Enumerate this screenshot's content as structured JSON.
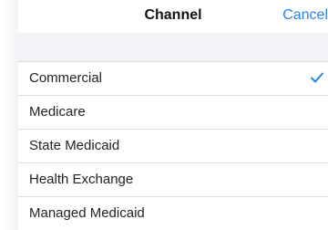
{
  "nav": {
    "title": "Channel",
    "cancel_label": "Cancel"
  },
  "options": [
    {
      "label": "Commercial",
      "selected": true
    },
    {
      "label": "Medicare",
      "selected": false
    },
    {
      "label": "State Medicaid",
      "selected": false
    },
    {
      "label": "Health Exchange",
      "selected": false
    },
    {
      "label": "Managed Medicaid",
      "selected": false
    }
  ],
  "colors": {
    "accent": "#2a84f0",
    "group_background": "#f2f2f7",
    "separator": "#dcdce0"
  },
  "icons": {
    "selected": "checkmark-icon"
  }
}
